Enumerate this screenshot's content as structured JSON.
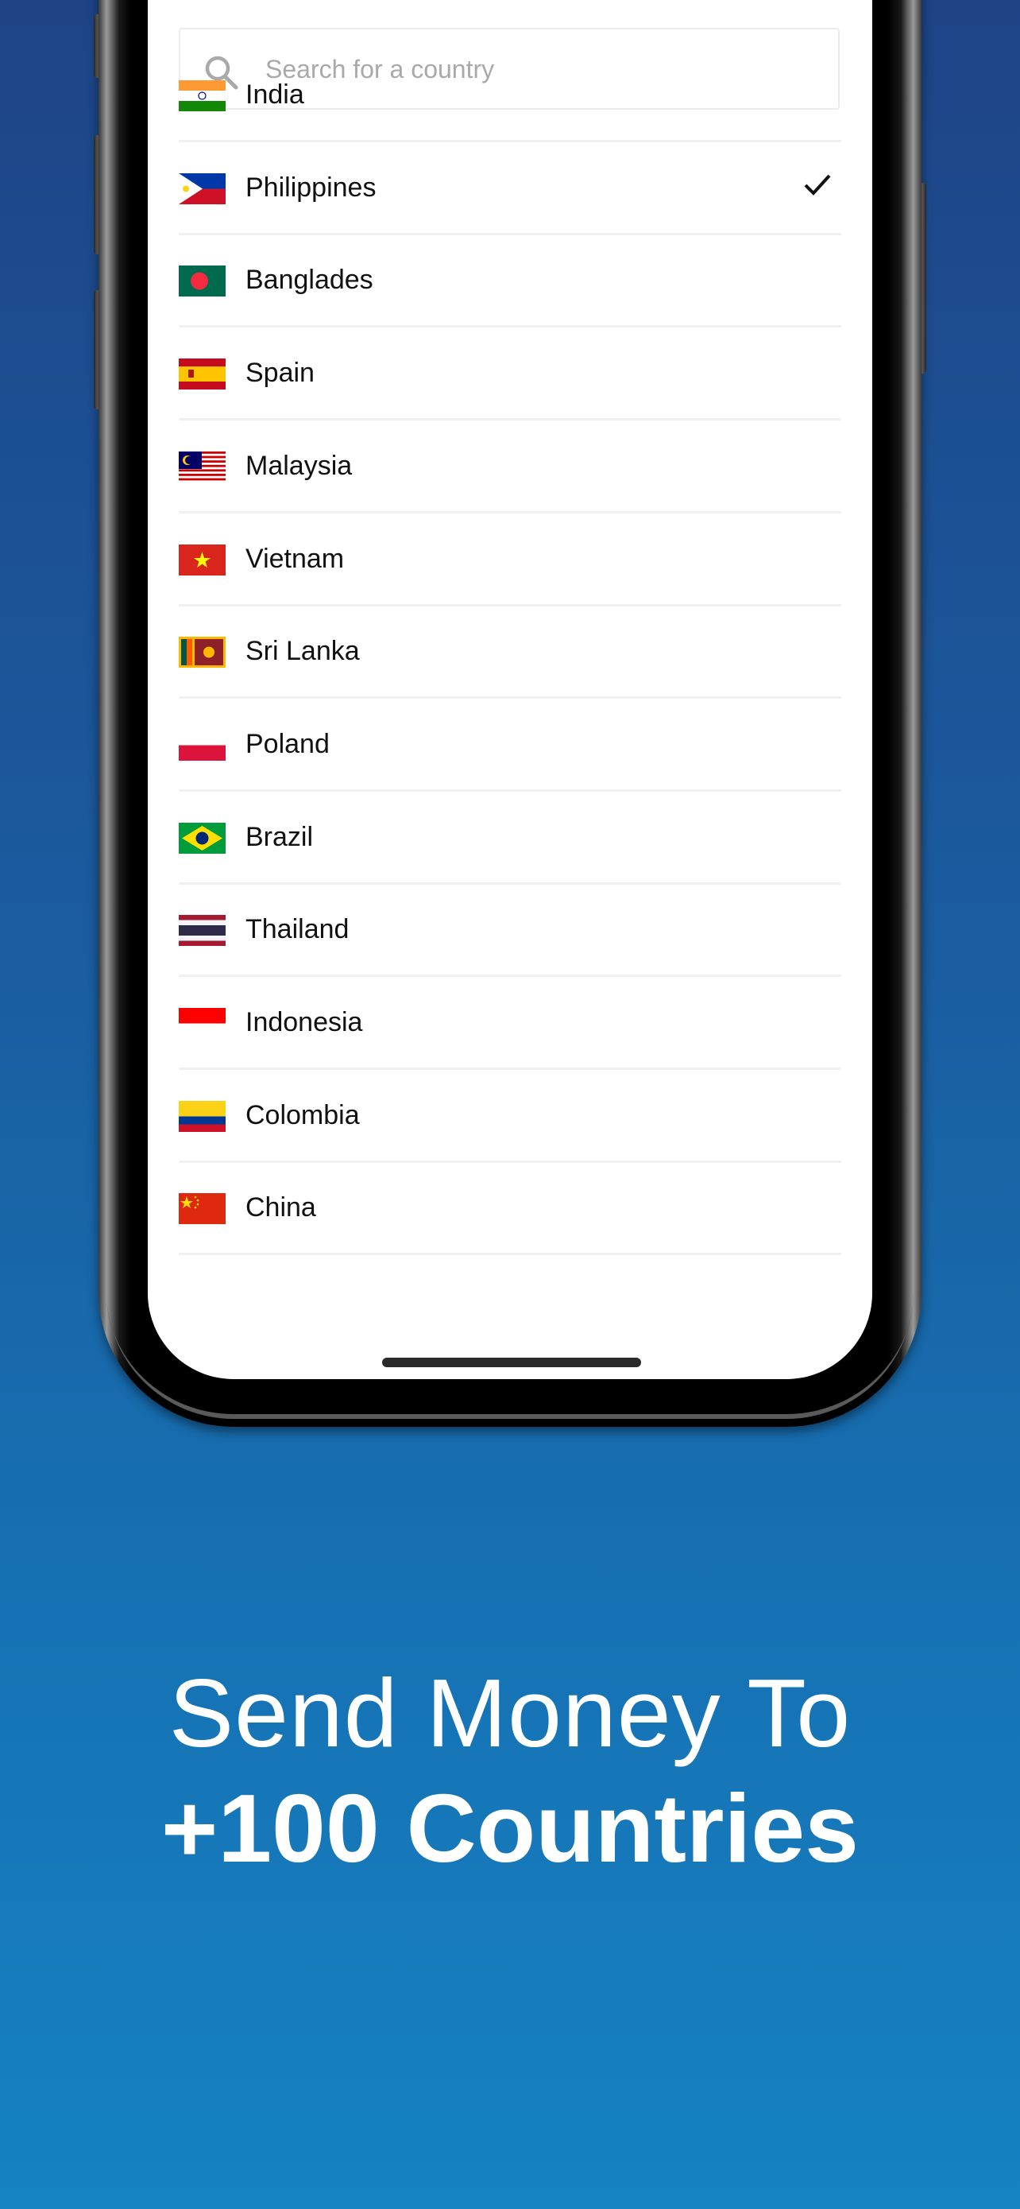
{
  "search": {
    "placeholder": "Search for a country",
    "icon": "search-icon"
  },
  "countries": [
    {
      "name": "India",
      "selected": false
    },
    {
      "name": "Philippines",
      "selected": true
    },
    {
      "name": "Banglades",
      "selected": false
    },
    {
      "name": "Spain",
      "selected": false
    },
    {
      "name": "Malaysia",
      "selected": false
    },
    {
      "name": "Vietnam",
      "selected": false
    },
    {
      "name": "Sri Lanka",
      "selected": false
    },
    {
      "name": "Poland",
      "selected": false
    },
    {
      "name": "Brazil",
      "selected": false
    },
    {
      "name": "Thailand",
      "selected": false
    },
    {
      "name": "Indonesia",
      "selected": false
    },
    {
      "name": "Colombia",
      "selected": false
    },
    {
      "name": "China",
      "selected": false
    }
  ],
  "headline": {
    "line1": "Send Money To",
    "line2": "+100 Countries"
  },
  "colors": {
    "background_top": "#1e4486",
    "background_bottom": "#1582c2",
    "text": "#ffffff"
  }
}
